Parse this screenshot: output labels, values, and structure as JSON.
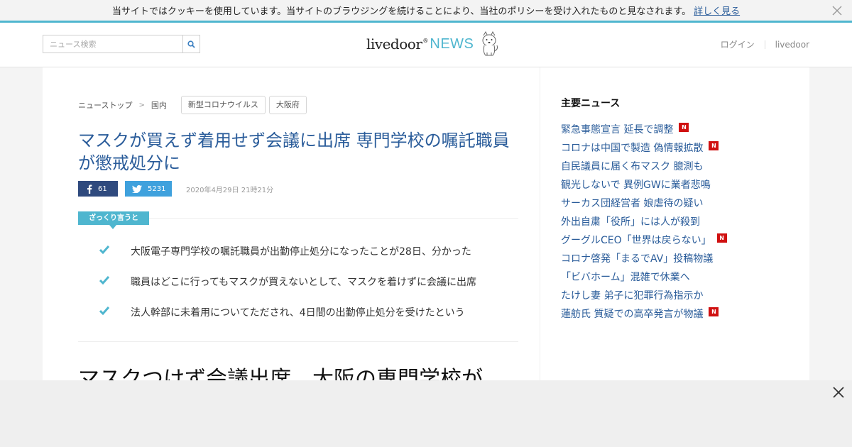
{
  "cookie_bar": {
    "message": "当サイトではクッキーを使用しています。当サイトのブラウジングを続けることにより、当社のポリシーを受け入れたものと見なされます。",
    "link_label": "詳しく見る"
  },
  "header": {
    "search_placeholder": "ニュース検索",
    "logo_main": "livedoor",
    "logo_sup": "®",
    "logo_news": "NEWS",
    "login_label": "ログイン",
    "livedoor_label": "livedoor"
  },
  "breadcrumb": {
    "home": "ニューストップ",
    "category": "国内",
    "tags": [
      "新型コロナウイルス",
      "大阪府"
    ]
  },
  "article": {
    "title": "マスクが買えず着用せず会議に出席 専門学校の嘱託職員が懲戒処分に",
    "facebook_count": "61",
    "twitter_count": "5231",
    "date": "2020年4月29日 21時21分",
    "summary_label": "ざっくり言うと",
    "summary": [
      "大阪電子専門学校の嘱託職員が出勤停止処分になったことが28日、分かった",
      "職員はどこに行ってもマスクが買えないとして、マスクを着けずに会議に出席",
      "法人幹部に未着用についてただされ、4日間の出勤停止処分を受けたという"
    ],
    "heading": "マスクつけず会議出席　大阪の専門学校が"
  },
  "sidebar": {
    "title": "主要ニュース",
    "badge_label": "N",
    "items": [
      {
        "label": "緊急事態宣言 延長で調整",
        "new": true
      },
      {
        "label": "コロナは中国で製造 偽情報拡散",
        "new": true
      },
      {
        "label": "自民議員に届く布マスク 臆測も",
        "new": false
      },
      {
        "label": "観光しないで 異例GWに業者悲鳴",
        "new": false
      },
      {
        "label": "サーカス団経営者 娘虐待の疑い",
        "new": false
      },
      {
        "label": "外出自粛「役所」には人が殺到",
        "new": false
      },
      {
        "label": "グーグルCEO「世界は戻らない」",
        "new": true
      },
      {
        "label": "コロナ啓発「まるでAV」投稿物議",
        "new": false
      },
      {
        "label": "「ビバホーム」混雑で休業へ",
        "new": false
      },
      {
        "label": "たけし妻 弟子に犯罪行為指示か",
        "new": false
      },
      {
        "label": "蓮舫氏 質疑での高卒発言が物議",
        "new": true
      }
    ]
  },
  "colors": {
    "accent": "#4fb6cf",
    "link": "#2a5c9a",
    "facebook": "#2f4a7e",
    "twitter": "#3fa1dd",
    "new_badge": "#d01010"
  }
}
